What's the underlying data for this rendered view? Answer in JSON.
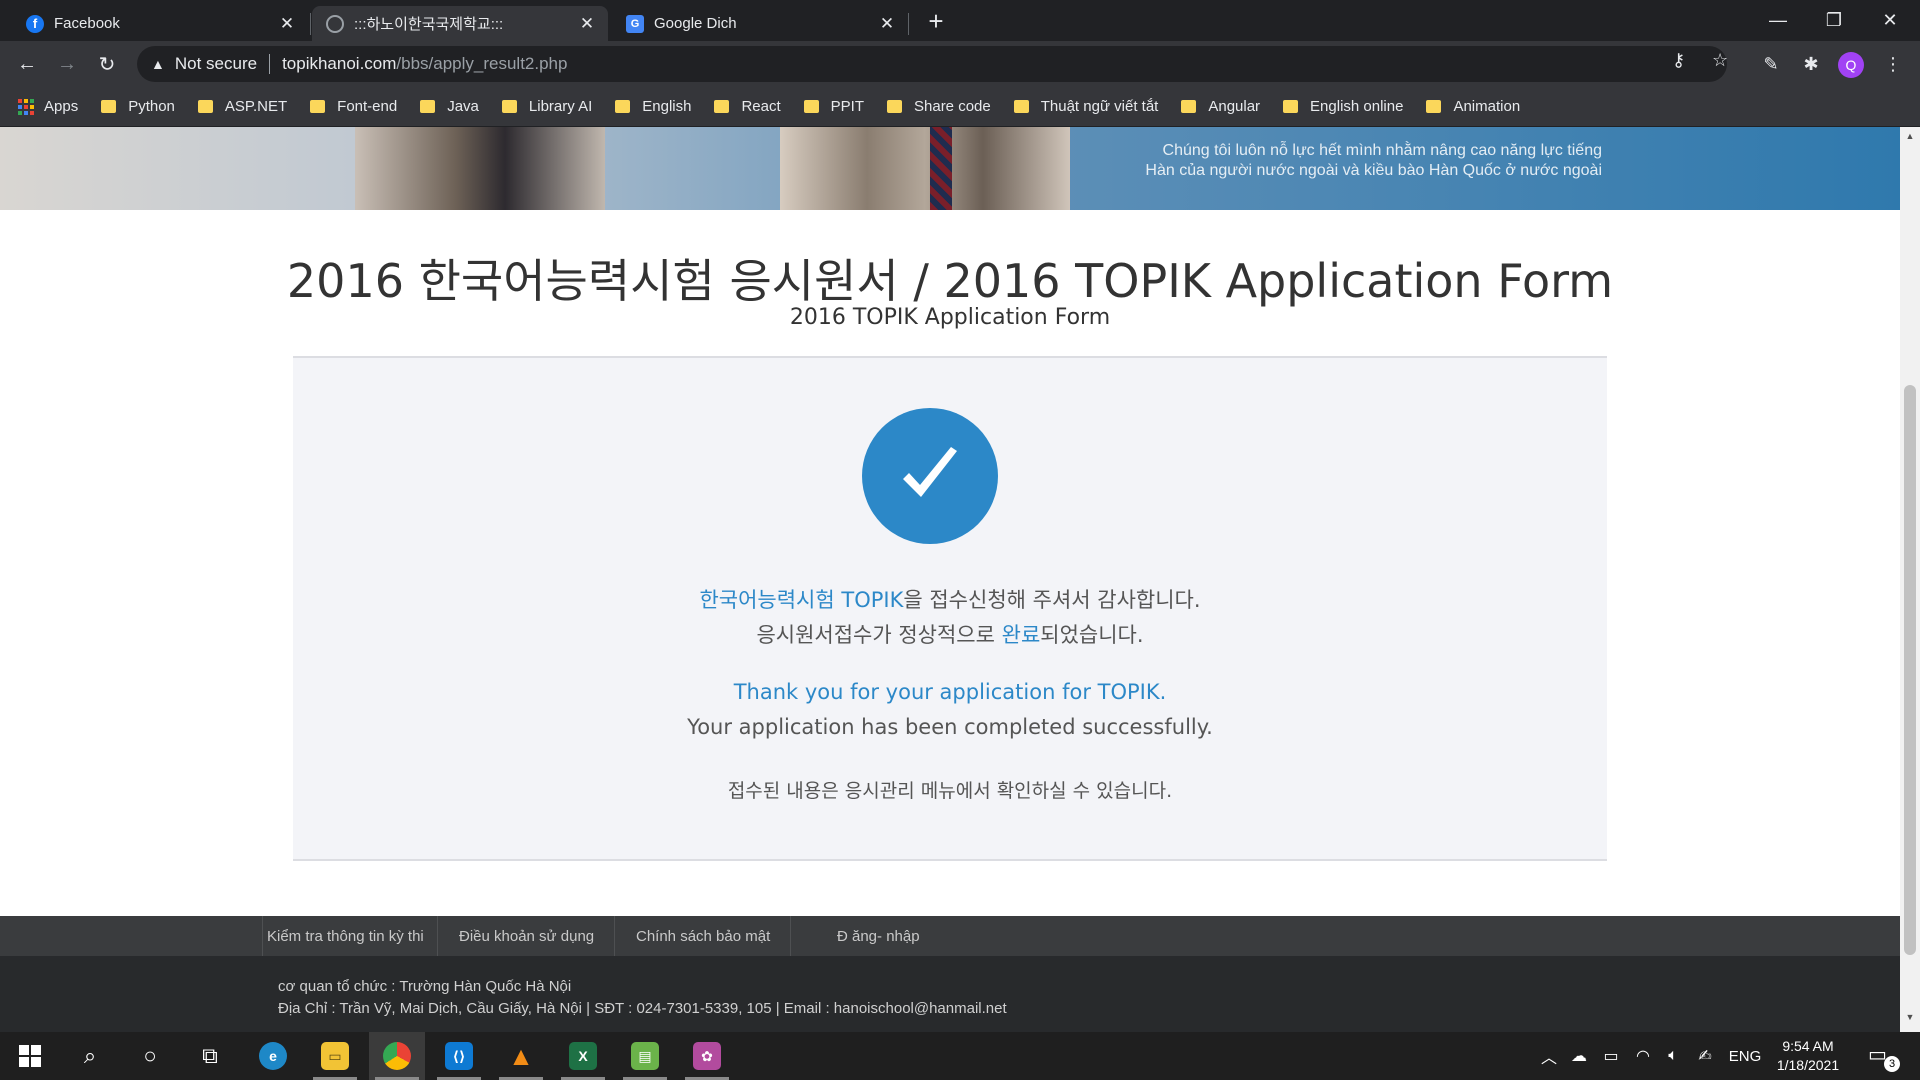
{
  "browser": {
    "tabs": [
      {
        "title": "Facebook",
        "icon": "facebook-icon",
        "active": false
      },
      {
        "title": ":::하노이한국국제학교:::",
        "icon": "globe-icon",
        "active": true
      },
      {
        "title": "Google Dich",
        "icon": "google-translate-icon",
        "active": false
      }
    ],
    "new_tab": "+",
    "window_controls": {
      "minimize": "—",
      "restore": "❐",
      "close": "✕"
    },
    "nav": {
      "back": "←",
      "forward": "→",
      "reload": "↻"
    },
    "address": {
      "security_label": "Not secure",
      "host": "topikhanoi.com",
      "path": "/bbs/apply_result2.php"
    },
    "profile_initial": "Q",
    "bookmarks": [
      "Apps",
      "Python",
      "ASP.NET",
      "Font-end",
      "Java",
      "Library AI",
      "English",
      "React",
      "PPIT",
      "Share code",
      "Thuật ngữ viết tắt",
      "Angular",
      "English online",
      "Animation"
    ]
  },
  "banner": {
    "slogan_line1": "Chúng tôi luôn nỗ lực hết mình nhằm nâng cao năng lực tiếng",
    "slogan_line2": "Hàn của người nước ngoài và kiều bào Hàn Quốc ở nước ngoài"
  },
  "page": {
    "title": "2016 한국어능력시험 응시원서 / 2016 TOPIK Application Form",
    "subtitle": "2016 TOPIK Application Form",
    "result": {
      "ko_line1_highlight": "한국어능력시험 TOPIK",
      "ko_line1_rest": "을 접수신청해 주셔서 감사합니다.",
      "ko_line2_pre": "응시원서접수가 정상적으로 ",
      "ko_line2_highlight": "완료",
      "ko_line2_post": "되었습니다.",
      "en_line1": "Thank you for your application for TOPIK.",
      "en_line2": "Your application has been completed successfully.",
      "ko_note": "접수된 내용은 응시관리 메뉴에서 확인하실 수 있습니다."
    },
    "accent_color": "#2c88c8"
  },
  "footer": {
    "nav": [
      "Kiểm tra thông tin kỳ thi",
      "Điều khoản sử dụng",
      "Chính sách bảo mật",
      "Đ ăng- nhập"
    ],
    "org_line": "cơ quan tổ chức :  Trường Hàn Quốc Hà Nội",
    "address_line": "Địa Chỉ : Trần Vỹ, Mai Dịch, Cầu Giấy, Hà Nội    |    SĐT : 024-7301-5339, 105    |    Email : hanoischool@hanmail.net"
  },
  "taskbar": {
    "apps": [
      "start-icon",
      "search-icon",
      "cortana-icon",
      "task-view-icon",
      "edge-icon",
      "file-explorer-icon",
      "chrome-icon",
      "vscode-icon",
      "vlc-icon",
      "excel-icon",
      "photo-icon",
      "paint-icon"
    ],
    "language": "ENG",
    "time": "9:54 AM",
    "date": "1/18/2021",
    "notification_count": "3"
  }
}
